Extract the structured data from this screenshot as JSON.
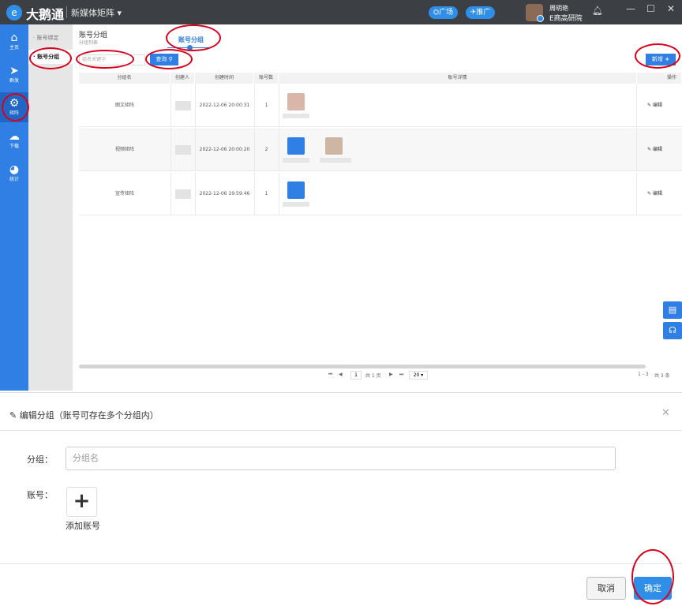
{
  "titlebar": {
    "brand": "大鹅通",
    "workspace": "新媒体矩阵",
    "plaza": "广场",
    "promote": "推广",
    "user_name": "周明艳",
    "org": "E商高研院"
  },
  "sidebar": {
    "items": [
      {
        "label": "主页",
        "icon": "home-icon"
      },
      {
        "label": "群发",
        "icon": "send-icon"
      },
      {
        "label": "矩阵",
        "icon": "gear-icon"
      },
      {
        "label": "下载",
        "icon": "cloud-download-icon"
      },
      {
        "label": "统计",
        "icon": "pie-chart-icon"
      }
    ]
  },
  "submenu": {
    "items": [
      {
        "label": "账号绑定"
      },
      {
        "label": "账号分组"
      }
    ]
  },
  "page": {
    "title": "账号分组",
    "subtitle": "分组列表",
    "tab": "账号分组",
    "search_placeholder": "组名关键字",
    "query_label": "查询",
    "new_label": "新增"
  },
  "table": {
    "headers": [
      "分组名",
      "创建人",
      "创建时间",
      "账号数",
      "账号详情",
      "操作"
    ],
    "rows": [
      {
        "name": "图文矩阵",
        "created": "2022-12-06 20:00:31",
        "count": "1",
        "op": "编辑"
      },
      {
        "name": "视频矩阵",
        "created": "2022-12-06 20:00:20",
        "count": "2",
        "op": "编辑"
      },
      {
        "name": "宣传矩阵",
        "created": "2022-12-06 19:59:46",
        "count": "1",
        "op": "编辑"
      }
    ]
  },
  "pager": {
    "page": "1",
    "total_pages": "共 1 页",
    "page_size": "20",
    "range": "1 - 3",
    "total": "共 3 条"
  },
  "dialog": {
    "title": "编辑分组（账号可存在多个分组内）",
    "group_label": "分组：",
    "group_placeholder": "分组名",
    "account_label": "账号：",
    "add_account": "添加账号",
    "cancel": "取消",
    "confirm": "确定"
  },
  "colors": {
    "primary": "#2f7fe4",
    "annotation": "#d9001b",
    "titlebar": "#3c3f43"
  }
}
